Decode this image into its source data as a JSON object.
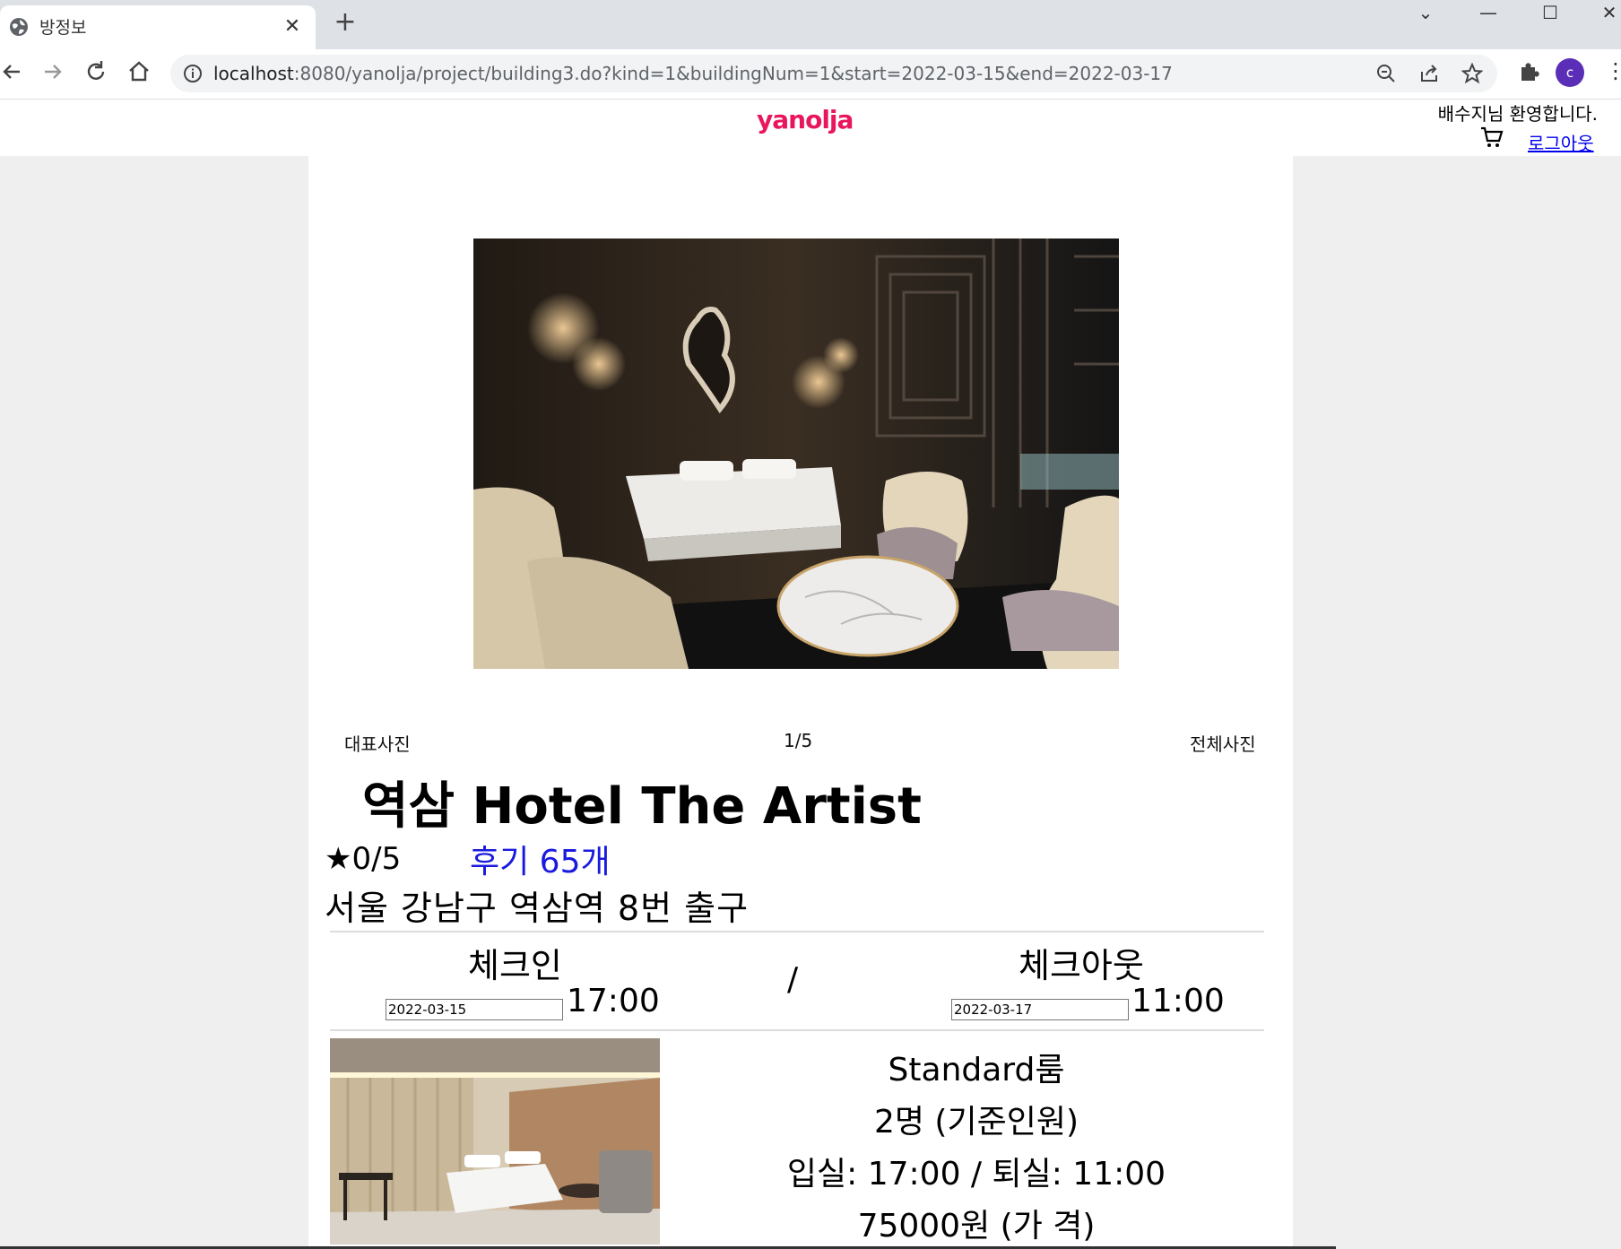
{
  "browser": {
    "tab_title": "방정보",
    "url_host": "localhost",
    "url_rest": ":8080/yanolja/project/building3.do?kind=1&buildingNum=1&start=2022-03-15&end=2022-03-17",
    "profile_initial": "c"
  },
  "header": {
    "logo": "yanolja",
    "welcome": "배수지님 환영합니다.",
    "logout": "로그아웃"
  },
  "gallery": {
    "left_label": "대표사진",
    "counter": "1/5",
    "right_label": "전체사진"
  },
  "hotel": {
    "name": "역삼 Hotel The Artist",
    "rating": "★0/5",
    "reviews": "후기 65개",
    "address": "서울 강남구 역삼역 8번 출구"
  },
  "stay": {
    "checkin_label": "체크인",
    "checkin_date": "2022-03-15",
    "checkin_time": "17:00",
    "separator": "/",
    "checkout_label": "체크아웃",
    "checkout_date": "2022-03-17",
    "checkout_time": "11:00"
  },
  "room": {
    "name": "Standard룸",
    "capacity": "2명 (기준인원)",
    "times": "입실: 17:00 / 퇴실: 11:00",
    "price": "75000원 (가 격)"
  }
}
